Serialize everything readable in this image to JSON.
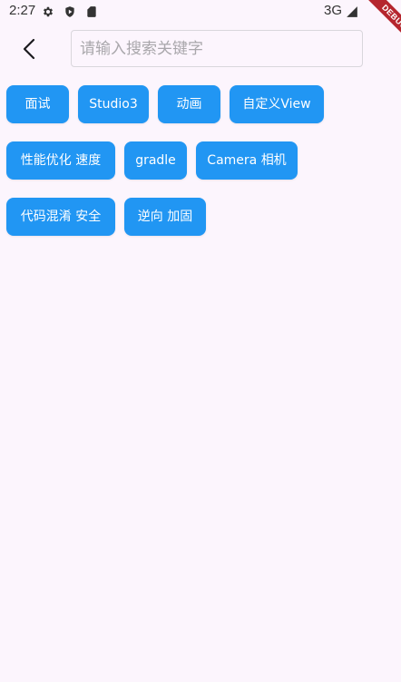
{
  "status_bar": {
    "time": "2:27",
    "network": "3G",
    "icons": [
      "settings-icon",
      "shield-icon",
      "sd-card-icon",
      "signal-icon"
    ]
  },
  "debug_banner": {
    "label": "DEBUG",
    "color": "#b5262e"
  },
  "header": {
    "back_icon": "chevron-left-icon",
    "search": {
      "placeholder": "请输入搜索关键字",
      "value": ""
    }
  },
  "tags": [
    {
      "label": "面试"
    },
    {
      "label": "Studio3"
    },
    {
      "label": "动画"
    },
    {
      "label": "自定义View"
    },
    {
      "label": "性能优化 速度"
    },
    {
      "label": "gradle"
    },
    {
      "label": "Camera 相机"
    },
    {
      "label": "代码混淆 安全"
    },
    {
      "label": "逆向 加固"
    }
  ],
  "colors": {
    "background": "#fcf5fd",
    "tag_background": "#2196f3",
    "tag_text": "#ffffff"
  }
}
